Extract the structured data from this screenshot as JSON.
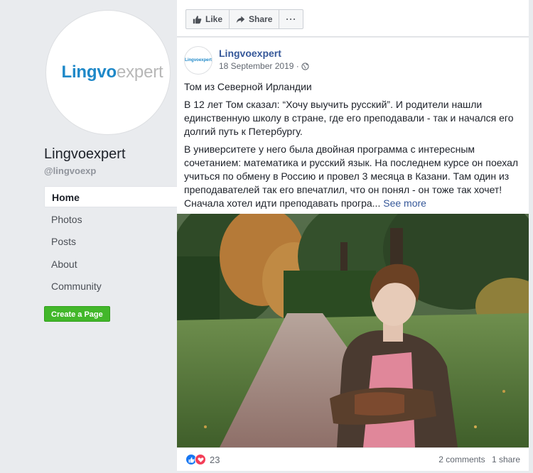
{
  "sidebar": {
    "logo": {
      "part1": "Lingvo",
      "part2": "expert"
    },
    "page_name": "Lingvoexpert",
    "handle": "@lingvoexp",
    "nav": [
      "Home",
      "Photos",
      "Posts",
      "About",
      "Community"
    ],
    "active_nav": "Home",
    "create_page_label": "Create a Page"
  },
  "actionbar": {
    "like_label": "Like",
    "share_label": "Share",
    "more_label": "···"
  },
  "post": {
    "author": "Lingvoexpert",
    "date": "18 September 2019 ·",
    "avatar_text": "Lingvoexpert",
    "title": "Том из Северной Ирландии",
    "paragraph1": "В 12 лет Том сказал: “Хочу выучить русский”. И родители нашли единственную школу в стране, где его преподавали - так и начался его долгий путь к Петербургу.",
    "paragraph2": "В университете у него была двойная программа с интересным сочетанием: математика и русский язык. На последнем курсе он поехал учиться по обмену в Россию и провел 3 месяца в Казани. Там один из преподавателей так его впечатлил, что он понял - он тоже так хочет! Сначала хотел идти преподавать програ...",
    "see_more": "See more",
    "reaction_count": "23",
    "comments": "2 comments",
    "shares": "1 share"
  },
  "colors": {
    "brand_blue": "#1e88c8",
    "link_blue": "#365899",
    "create_green": "#42b72a",
    "like_blue": "#1877f2",
    "love_red": "#f33e58"
  },
  "icons": {
    "like": "thumbs-up-icon",
    "share": "share-arrow-icon",
    "more": "ellipsis-icon",
    "privacy": "globe-icon",
    "reaction_like": "like-reaction-icon",
    "reaction_love": "love-reaction-icon"
  }
}
